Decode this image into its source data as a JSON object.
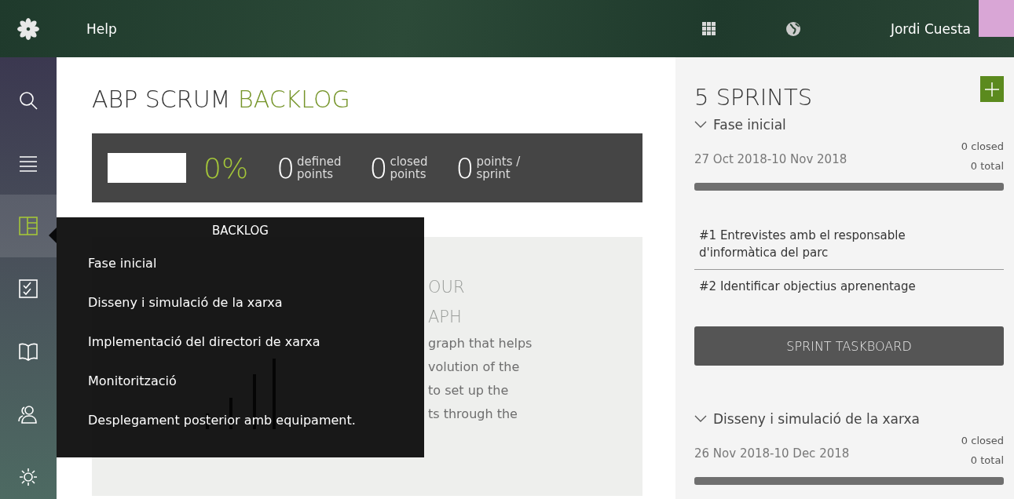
{
  "topbar": {
    "help": "Help",
    "user": "Jordi Cuesta"
  },
  "sidebar": {
    "items": [
      {
        "selected": false
      },
      {
        "selected": false
      },
      {
        "selected": true
      },
      {
        "selected": false
      },
      {
        "selected": false
      },
      {
        "selected": false
      },
      {
        "selected": false
      }
    ]
  },
  "title": {
    "prefix": "ABP SCRUM",
    "accent": "BACKLOG"
  },
  "stats": {
    "percent": "0%",
    "items": [
      {
        "value": "0",
        "label": "defined\npoints"
      },
      {
        "value": "0",
        "label": "closed\npoints"
      },
      {
        "value": "0",
        "label": "points /\nsprint"
      }
    ]
  },
  "graph_card": {
    "heading_lines": [
      "OUR",
      "APH"
    ],
    "text_lines": [
      "graph that helps",
      "volution of the",
      "to set up the",
      "ts through the"
    ]
  },
  "tooltip": {
    "title": "BACKLOG",
    "items": [
      "Fase inicial",
      "Disseny i simulació de la xarxa",
      "Implementació del directori de xarxa",
      "Monitorització",
      "Desplegament posterior amb equipament."
    ]
  },
  "sprints": {
    "title": "5 SPRINTS",
    "list": [
      {
        "name": "Fase inicial",
        "expanded": true,
        "closed": "0 closed",
        "dates": "27 Oct 2018-10 Nov 2018",
        "total": "0 total",
        "level": 0,
        "stories": [
          "#1 Entrevistes amb el responsable d'informàtica del parc",
          "#2 Identificar objectius aprenentage"
        ],
        "button": "SPRINT TASKBOARD"
      },
      {
        "name": "Disseny i simulació de la xarxa",
        "expanded": true,
        "closed": "0 closed",
        "dates": "26 Nov 2018-10 Dec 2018",
        "total": "0 total",
        "level": 0
      }
    ]
  }
}
